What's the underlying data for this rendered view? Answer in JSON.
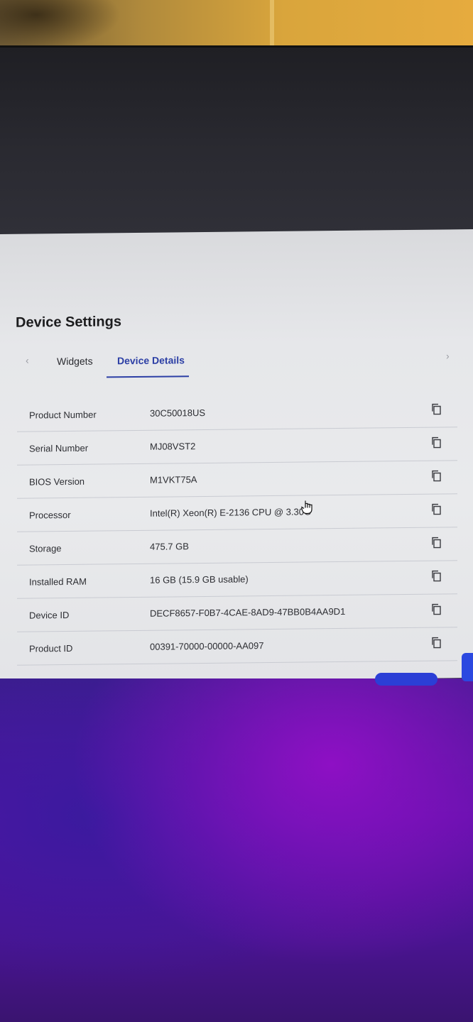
{
  "settings": {
    "title": "Device Settings",
    "tabs": {
      "prev_glyph": "‹",
      "next_glyph": "›",
      "items": [
        {
          "label": "Widgets",
          "active": false
        },
        {
          "label": "Device Details",
          "active": true
        }
      ]
    },
    "details": [
      {
        "label": "Product Number",
        "value": "30C50018US",
        "icon": "copy-icon"
      },
      {
        "label": "Serial Number",
        "value": "MJ08VST2",
        "icon": "copy-icon"
      },
      {
        "label": "BIOS Version",
        "value": "M1VKT75A",
        "icon": "copy-icon"
      },
      {
        "label": "Processor",
        "value": "Intel(R) Xeon(R) E-2136 CPU @ 3.30G",
        "icon": "copy-icon"
      },
      {
        "label": "Storage",
        "value": "475.7 GB",
        "icon": "copy-icon"
      },
      {
        "label": "Installed RAM",
        "value": "16 GB (15.9 GB usable)",
        "icon": "copy-icon"
      },
      {
        "label": "Device ID",
        "value": "DECF8657-F0B7-4CAE-8AD9-47BB0B4AA9D1",
        "icon": "copy-icon"
      },
      {
        "label": "Product ID",
        "value": "00391-70000-00000-AA097",
        "icon": "copy-icon"
      }
    ]
  },
  "colors": {
    "accent": "#2c3fa5",
    "panel_bg": "#e6e7ea",
    "desktop_purple": "#8e10c4"
  }
}
